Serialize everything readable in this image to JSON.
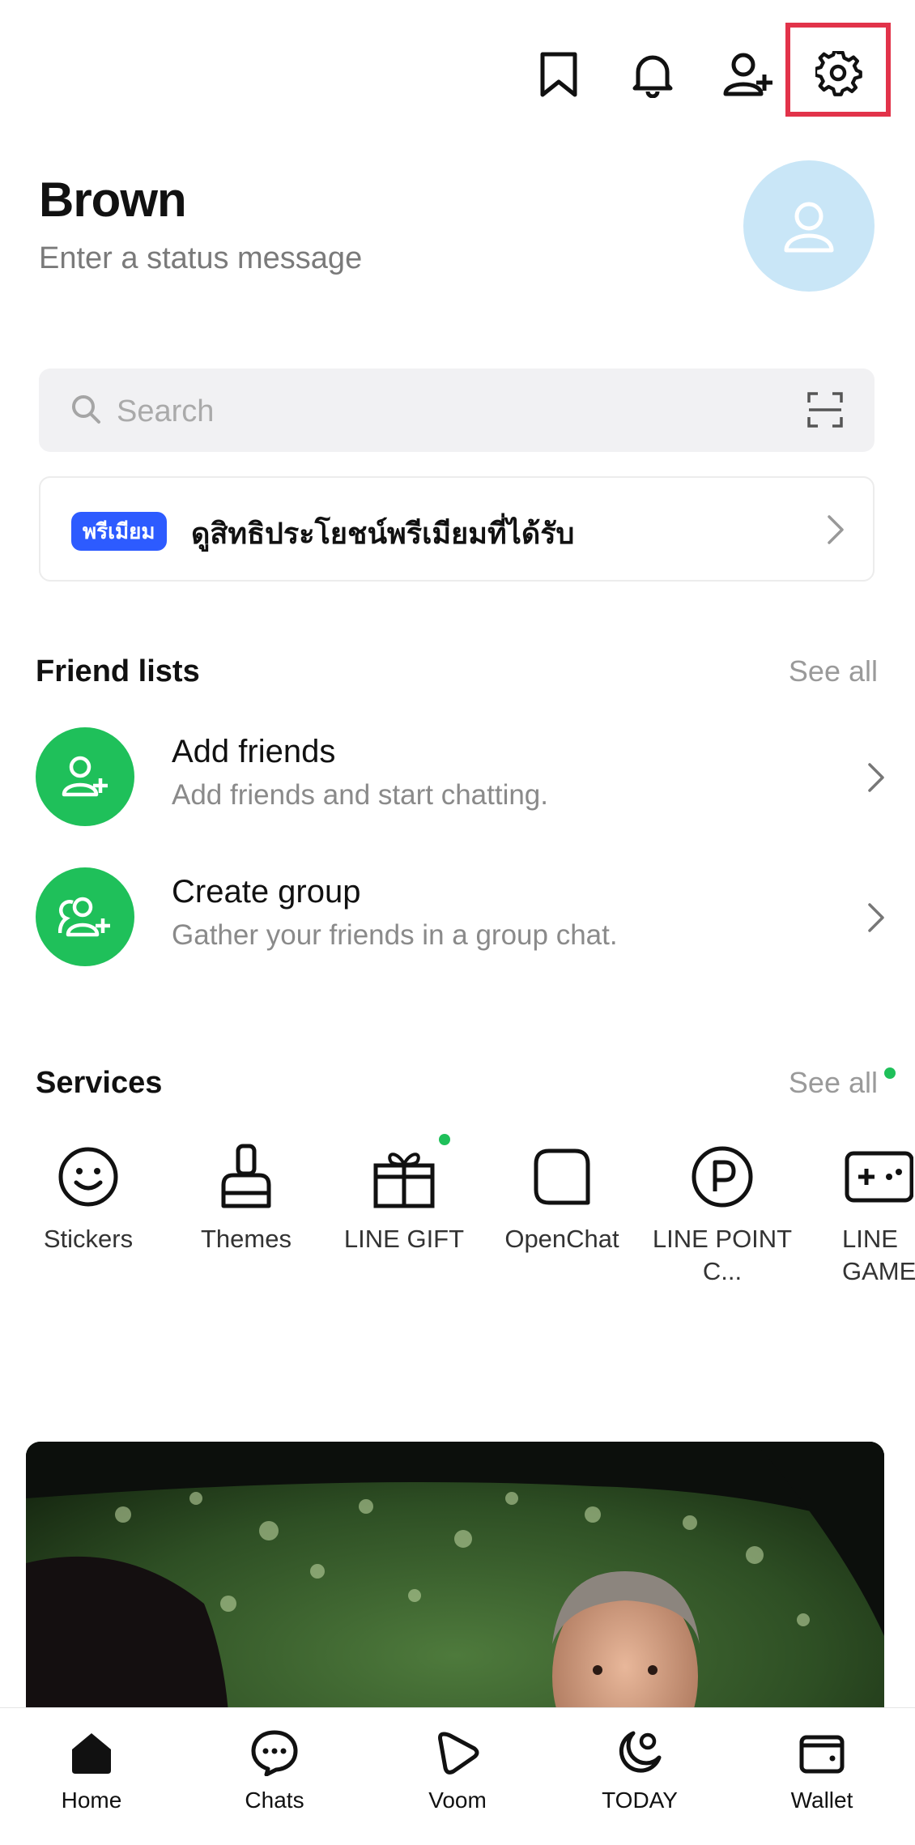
{
  "topbar": {
    "icons": [
      "bookmark-icon",
      "bell-icon",
      "add-friend-icon",
      "gear-icon"
    ],
    "highlight_color": "#e2334a"
  },
  "profile": {
    "name": "Brown",
    "status_placeholder": "Enter a status message"
  },
  "search": {
    "placeholder": "Search"
  },
  "premium": {
    "badge": "พรีเมียม",
    "text": "ดูสิทธิประโยชน์พรีเมียมที่ได้รับ"
  },
  "friend_lists": {
    "title": "Friend lists",
    "see_all": "See all",
    "items": [
      {
        "title": "Add friends",
        "subtitle": "Add friends and start chatting."
      },
      {
        "title": "Create group",
        "subtitle": "Gather your friends in a group chat."
      }
    ]
  },
  "services": {
    "title": "Services",
    "see_all": "See all",
    "items": [
      {
        "label": "Stickers"
      },
      {
        "label": "Themes"
      },
      {
        "label": "LINE GIFT"
      },
      {
        "label": "OpenChat"
      },
      {
        "label": "LINE POINT C..."
      },
      {
        "label": "LINE GAME"
      }
    ]
  },
  "bottom_nav": {
    "items": [
      {
        "label": "Home"
      },
      {
        "label": "Chats"
      },
      {
        "label": "Voom"
      },
      {
        "label": "TODAY"
      },
      {
        "label": "Wallet"
      }
    ]
  },
  "colors": {
    "brand_green": "#1fc05a",
    "premium_blue": "#2d5bff",
    "avatar_bg": "#c9e6f7"
  }
}
